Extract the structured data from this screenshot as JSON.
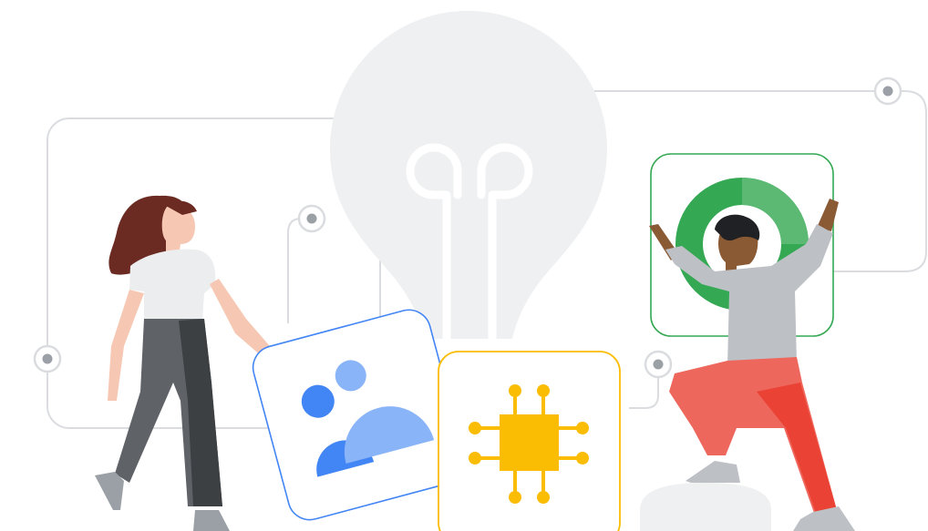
{
  "illustration": {
    "icons": [
      "lightbulb-icon",
      "people-icon",
      "chip-icon",
      "donut-icon"
    ],
    "colors": {
      "blue": "#4285F4",
      "light_blue": "#8AB4F8",
      "yellow": "#FBBC04",
      "green": "#34A853",
      "light_green": "#5BB974",
      "red": "#EA4335",
      "coral": "#EE675C",
      "gray_line": "#DADCE0",
      "bulb_gray": "#EFF0F1",
      "hair_brown": "#6B2A22",
      "skin": "#F6C8B4",
      "skin_dark": "#8A5A35"
    }
  }
}
